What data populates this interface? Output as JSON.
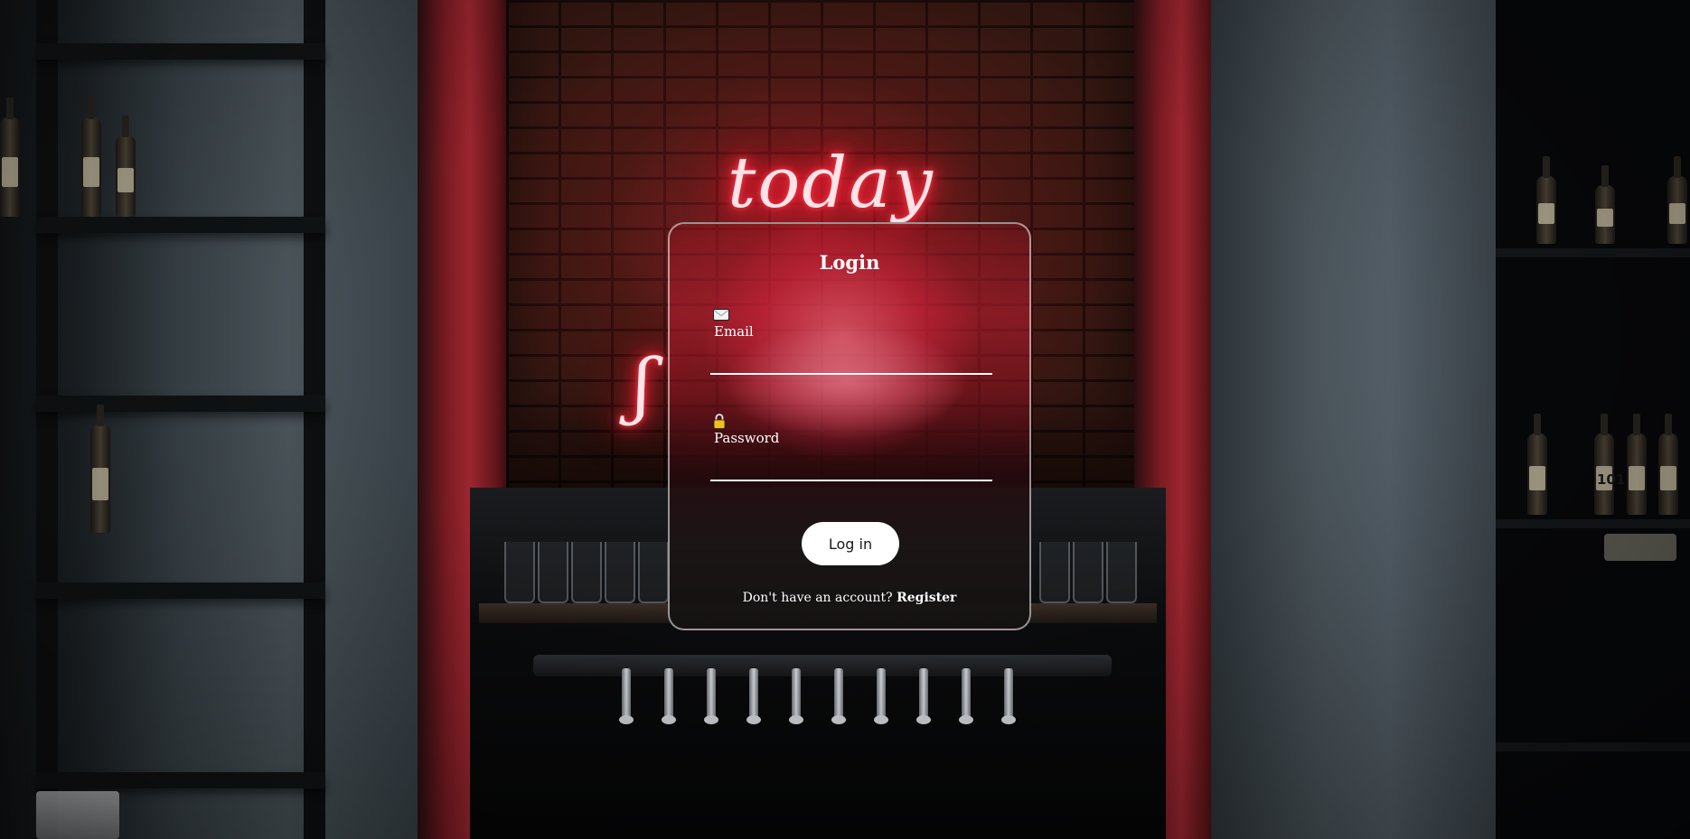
{
  "login": {
    "title": "Login",
    "email_label": "Email",
    "email_icon": "envelope-icon",
    "email_value": "",
    "password_label": "Password",
    "password_icon": "lock-icon",
    "password_value": "",
    "submit_label": "Log in",
    "register_prompt": "Don't have an account?",
    "register_link": "Register"
  },
  "background": {
    "neon_sign_word": "today",
    "right_shelf_label": "101"
  },
  "colors": {
    "accent_red": "#c8142e",
    "text": "#ffffff",
    "button_bg": "#ffffff",
    "button_text": "#1a1a1a"
  }
}
